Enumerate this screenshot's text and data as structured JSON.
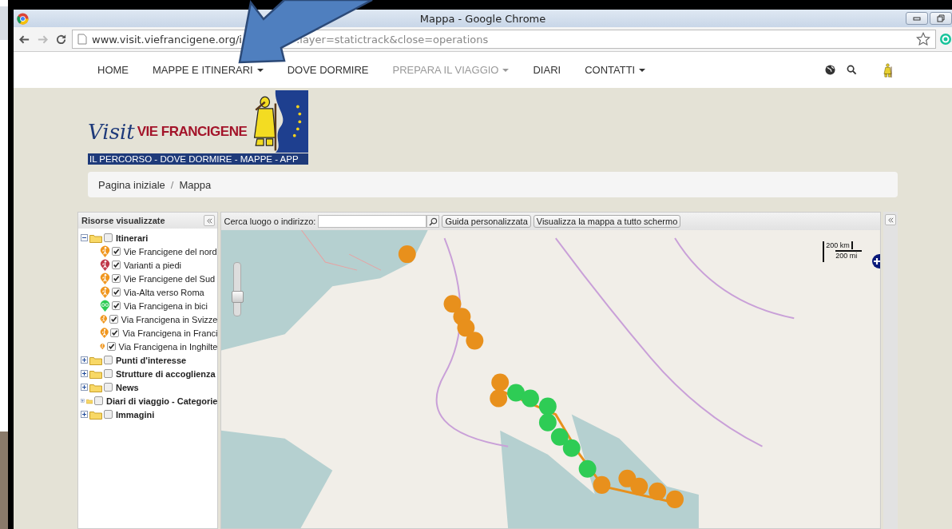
{
  "browser": {
    "title": "Mappa - Google Chrome",
    "url_start": "www.visit.viefrancigene.org/i",
    "url_end": ":layer=statictrack&close=operations"
  },
  "nav": {
    "items": [
      {
        "label": "HOME",
        "dropdown": false,
        "disabled": false
      },
      {
        "label": "MAPPE E ITINERARI",
        "dropdown": true,
        "disabled": false
      },
      {
        "label": "DOVE DORMIRE",
        "dropdown": false,
        "disabled": false
      },
      {
        "label": "PREPARA IL VIAGGIO",
        "dropdown": true,
        "disabled": true
      },
      {
        "label": "DIARI",
        "dropdown": false,
        "disabled": false
      },
      {
        "label": "CONTATTI",
        "dropdown": true,
        "disabled": false
      }
    ]
  },
  "logo": {
    "script": "Visit",
    "name": "VIE FRANCIGENE",
    "tagline": "IL PERCORSO - DOVE DORMIRE - MAPPE - APP"
  },
  "breadcrumb": [
    "Pagina iniziale",
    "Mappa"
  ],
  "breadcrumb_separator": "/",
  "sidebar": {
    "title": "Risorse visualizzate",
    "tree": [
      {
        "label": "Itinerari",
        "expanded": true,
        "checked": false,
        "children": [
          {
            "label": "Vie Francigene del nord",
            "checked": true,
            "color": "#f0961e",
            "kind": "walk"
          },
          {
            "label": "Varianti a piedi",
            "checked": true,
            "color": "#c0394b",
            "kind": "walk"
          },
          {
            "label": "Vie Francigene del Sud",
            "checked": true,
            "color": "#f0961e",
            "kind": "walk"
          },
          {
            "label": "Via-Alta verso Roma",
            "checked": true,
            "color": "#f0961e",
            "kind": "walk"
          },
          {
            "label": "Via Francigena in bici",
            "checked": true,
            "color": "#2ecc55",
            "kind": "bike"
          },
          {
            "label": "Via Francigena in Svizze",
            "checked": true,
            "color": "#f0961e",
            "kind": "walk"
          },
          {
            "label": "Via Francigena in Franci",
            "checked": true,
            "color": "#f0961e",
            "kind": "walk"
          },
          {
            "label": "Via Francigena in Inghilte",
            "checked": true,
            "color": "#f0961e",
            "kind": "walk"
          }
        ]
      },
      {
        "label": "Punti d'interesse",
        "expanded": false,
        "checked": false
      },
      {
        "label": "Strutture di accoglienza",
        "expanded": false,
        "checked": false
      },
      {
        "label": "News",
        "expanded": false,
        "checked": false
      },
      {
        "label": "Diari di viaggio - Categorie",
        "expanded": false,
        "checked": false
      },
      {
        "label": "Immagini",
        "expanded": false,
        "checked": false
      }
    ]
  },
  "map_toolbar": {
    "search_label": "Cerca luogo o indirizzo:",
    "buttons": [
      "Guida personalizzata",
      "Visualizza la mappa a tutto schermo"
    ]
  },
  "map": {
    "zoom": {
      "level": 0.35
    },
    "scale": [
      "200 km",
      "200 mi"
    ]
  }
}
